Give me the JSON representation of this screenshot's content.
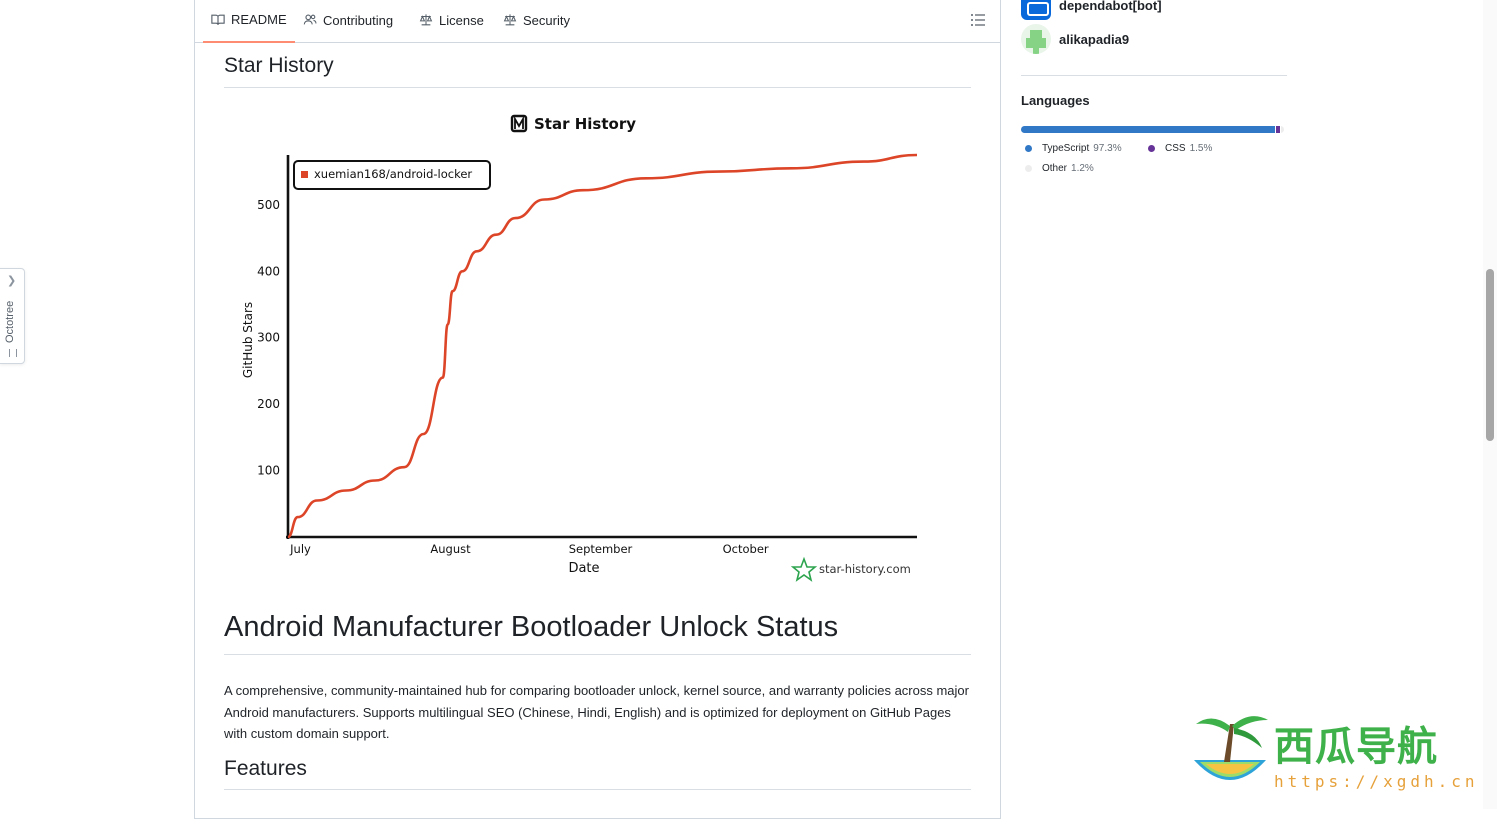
{
  "octotree": {
    "label": "Octotree"
  },
  "tabs": [
    {
      "label": "README",
      "icon": "book-icon",
      "active": true
    },
    {
      "label": "Contributing",
      "icon": "people-icon",
      "active": false
    },
    {
      "label": "License",
      "icon": "law-icon",
      "active": false
    },
    {
      "label": "Security",
      "icon": "law-icon",
      "active": false
    }
  ],
  "readme": {
    "star_history_heading": "Star History",
    "main_heading": "Android Manufacturer Bootloader Unlock Status",
    "description": "A comprehensive, community-maintained hub for comparing bootloader unlock, kernel source, and warranty policies across major Android manufacturers. Supports multilingual SEO (Chinese, Hindi, English) and is optimized for deployment on GitHub Pages with custom domain support.",
    "features_heading": "Features"
  },
  "chart_data": {
    "type": "line",
    "title": "Star History",
    "xlabel": "Date",
    "ylabel": "GitHub Stars",
    "x_ticks": [
      "July",
      "August",
      "September",
      "October"
    ],
    "y_ticks": [
      100,
      200,
      300,
      400,
      500
    ],
    "ylim": [
      0,
      575
    ],
    "legend": "top-left",
    "credit": "star-history.com",
    "series": [
      {
        "name": "xuemian168/android-locker",
        "color": "#dd4528",
        "x": [
          "2025-06-28",
          "2025-06-30",
          "2025-07-04",
          "2025-07-10",
          "2025-07-16",
          "2025-07-22",
          "2025-07-26",
          "2025-07-30",
          "2025-07-31",
          "2025-08-01",
          "2025-08-03",
          "2025-08-06",
          "2025-08-10",
          "2025-08-14",
          "2025-08-20",
          "2025-08-28",
          "2025-09-10",
          "2025-09-25",
          "2025-10-10",
          "2025-10-25",
          "2025-11-05"
        ],
        "values": [
          0,
          30,
          55,
          70,
          85,
          105,
          155,
          240,
          320,
          370,
          400,
          430,
          455,
          480,
          508,
          522,
          540,
          550,
          555,
          565,
          575
        ]
      }
    ]
  },
  "sidebar": {
    "contributors": [
      {
        "name": "dependabot[bot]"
      },
      {
        "name": "alikapadia9"
      }
    ],
    "languages_title": "Languages",
    "languages": [
      {
        "name": "TypeScript",
        "percent": "97.3%",
        "value": 97.3,
        "color": "#3178c6"
      },
      {
        "name": "CSS",
        "percent": "1.5%",
        "value": 1.5,
        "color": "#663399"
      },
      {
        "name": "Other",
        "percent": "1.2%",
        "value": 1.2,
        "color": "#ededed"
      }
    ]
  },
  "watermark": {
    "text": "西瓜导航",
    "url": "https://xgdh.cn"
  }
}
